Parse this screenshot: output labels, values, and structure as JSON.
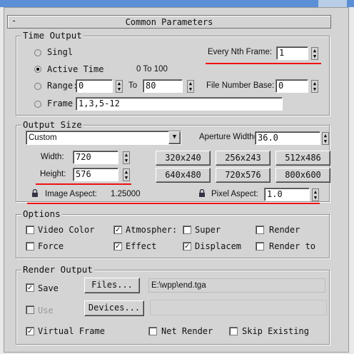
{
  "panel": {
    "title": "Common Parameters",
    "collapse_label": "-"
  },
  "time_output": {
    "legend": "Time Output",
    "options": [
      {
        "label": "Singl",
        "selected": false
      },
      {
        "label": "Active Time",
        "selected": true,
        "range_text": "0 To 100"
      },
      {
        "label": "Range:",
        "selected": false
      },
      {
        "label": "Frame",
        "selected": false
      }
    ],
    "nth_frame_label": "Every Nth Frame:",
    "nth_frame_value": "1",
    "range_start": "0",
    "range_to": "To",
    "range_end": "80",
    "file_number_base_label": "File Number Base:",
    "file_number_base_value": "0",
    "frames_value": "1,3,5-12"
  },
  "output_size": {
    "legend": "Output Size",
    "preset": "Custom",
    "aperture_label": "Aperture Width(mm):",
    "aperture_value": "36.0",
    "width_label": "Width:",
    "width_value": "720",
    "height_label": "Height:",
    "height_value": "576",
    "resolutions": [
      "320x240",
      "256x243",
      "512x486",
      "640x480",
      "720x576",
      "800x600"
    ],
    "image_aspect_label": "Image Aspect:",
    "image_aspect_value": "1.25000",
    "pixel_aspect_label": "Pixel Aspect:",
    "pixel_aspect_value": "1.0"
  },
  "options": {
    "legend": "Options",
    "items": [
      {
        "label": "Video Color",
        "checked": false
      },
      {
        "label": "Atmospher:",
        "checked": true
      },
      {
        "label": "Super",
        "checked": false
      },
      {
        "label": "Render",
        "checked": false
      },
      {
        "label": "Force",
        "checked": false
      },
      {
        "label": "Effect",
        "checked": true
      },
      {
        "label": "Displacem",
        "checked": true
      },
      {
        "label": "Render to",
        "checked": false
      }
    ]
  },
  "render_output": {
    "legend": "Render Output",
    "save_label": "Save",
    "files_button": "Files...",
    "path": "E:\\wpp\\end.tga",
    "use_label": "Use",
    "devices_button": "Devices...",
    "virtual_frame_label": "Virtual Frame",
    "net_render_label": "Net Render",
    "skip_label": "Skip Existing"
  },
  "colors": {
    "highlight": "#e11111",
    "titlebar": "#5b8fd6"
  }
}
